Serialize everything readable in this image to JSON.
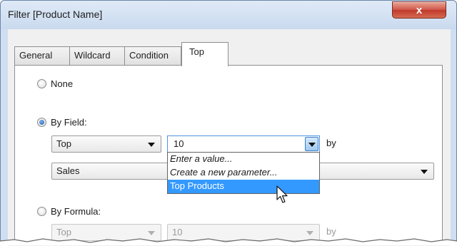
{
  "window": {
    "title": "Filter [Product Name]",
    "close_glyph": "x"
  },
  "tabs": [
    {
      "label": "General",
      "active": false
    },
    {
      "label": "Wildcard",
      "active": false
    },
    {
      "label": "Condition",
      "active": false
    },
    {
      "label": "Top",
      "active": true
    }
  ],
  "options": {
    "none": {
      "label": "None",
      "checked": false
    },
    "by_field": {
      "label": "By Field:",
      "checked": true
    },
    "by_formula": {
      "label": "By Formula:",
      "checked": false
    }
  },
  "by_field": {
    "direction": "Top",
    "count_value": "10",
    "by_label": "by",
    "field": "Sales"
  },
  "count_dropdown": {
    "items": [
      {
        "label": "Enter a value...",
        "style": "italic",
        "selected": false
      },
      {
        "label": "Create a new parameter...",
        "style": "italic",
        "selected": false
      },
      {
        "label": "Top Products",
        "style": "normal",
        "selected": true
      }
    ]
  },
  "by_formula": {
    "direction": "Top",
    "count_value": "10",
    "by_label": "by"
  },
  "colors": {
    "titlebar": "#cfdef0",
    "selection": "#3399ff",
    "close_button": "#c0392b"
  },
  "icons": [
    "close-icon",
    "radio-icon",
    "dropdown-arrow-icon",
    "mouse-pointer-icon"
  ]
}
